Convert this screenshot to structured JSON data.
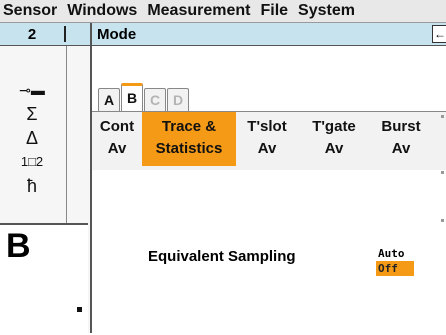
{
  "menu": [
    "Sensor",
    "Windows",
    "Measurement",
    "File",
    "System"
  ],
  "sidebar": {
    "channel": "2",
    "icons": [
      "sensor-probe-icon",
      "sigma-icon",
      "delta-icon",
      "ratio-icon",
      "tuner-icon"
    ],
    "glyphs": [
      "⊸▬",
      "Σ",
      "Δ",
      "1□2",
      "ħ"
    ],
    "window_letter": "B"
  },
  "panel": {
    "title": "Mode",
    "back_glyph": "←",
    "tabs": [
      {
        "label": "A",
        "state": "normal"
      },
      {
        "label": "B",
        "state": "active"
      },
      {
        "label": "C",
        "state": "disabled"
      },
      {
        "label": "D",
        "state": "disabled"
      }
    ],
    "functions": [
      {
        "line1": "Cont",
        "line2": "Av",
        "selected": false
      },
      {
        "line1": "Trace &",
        "line2": "Statistics",
        "selected": true
      },
      {
        "line1": "T'slot",
        "line2": "Av",
        "selected": false
      },
      {
        "line1": "T'gate",
        "line2": "Av",
        "selected": false
      },
      {
        "line1": "Burst",
        "line2": "Av",
        "selected": false
      }
    ],
    "equivalent_sampling": {
      "label": "Equivalent Sampling",
      "options": [
        "Auto",
        "Off"
      ],
      "selected": "Off"
    }
  },
  "colors": {
    "accent": "#f59a16",
    "titlebar": "#c7e4ee"
  }
}
